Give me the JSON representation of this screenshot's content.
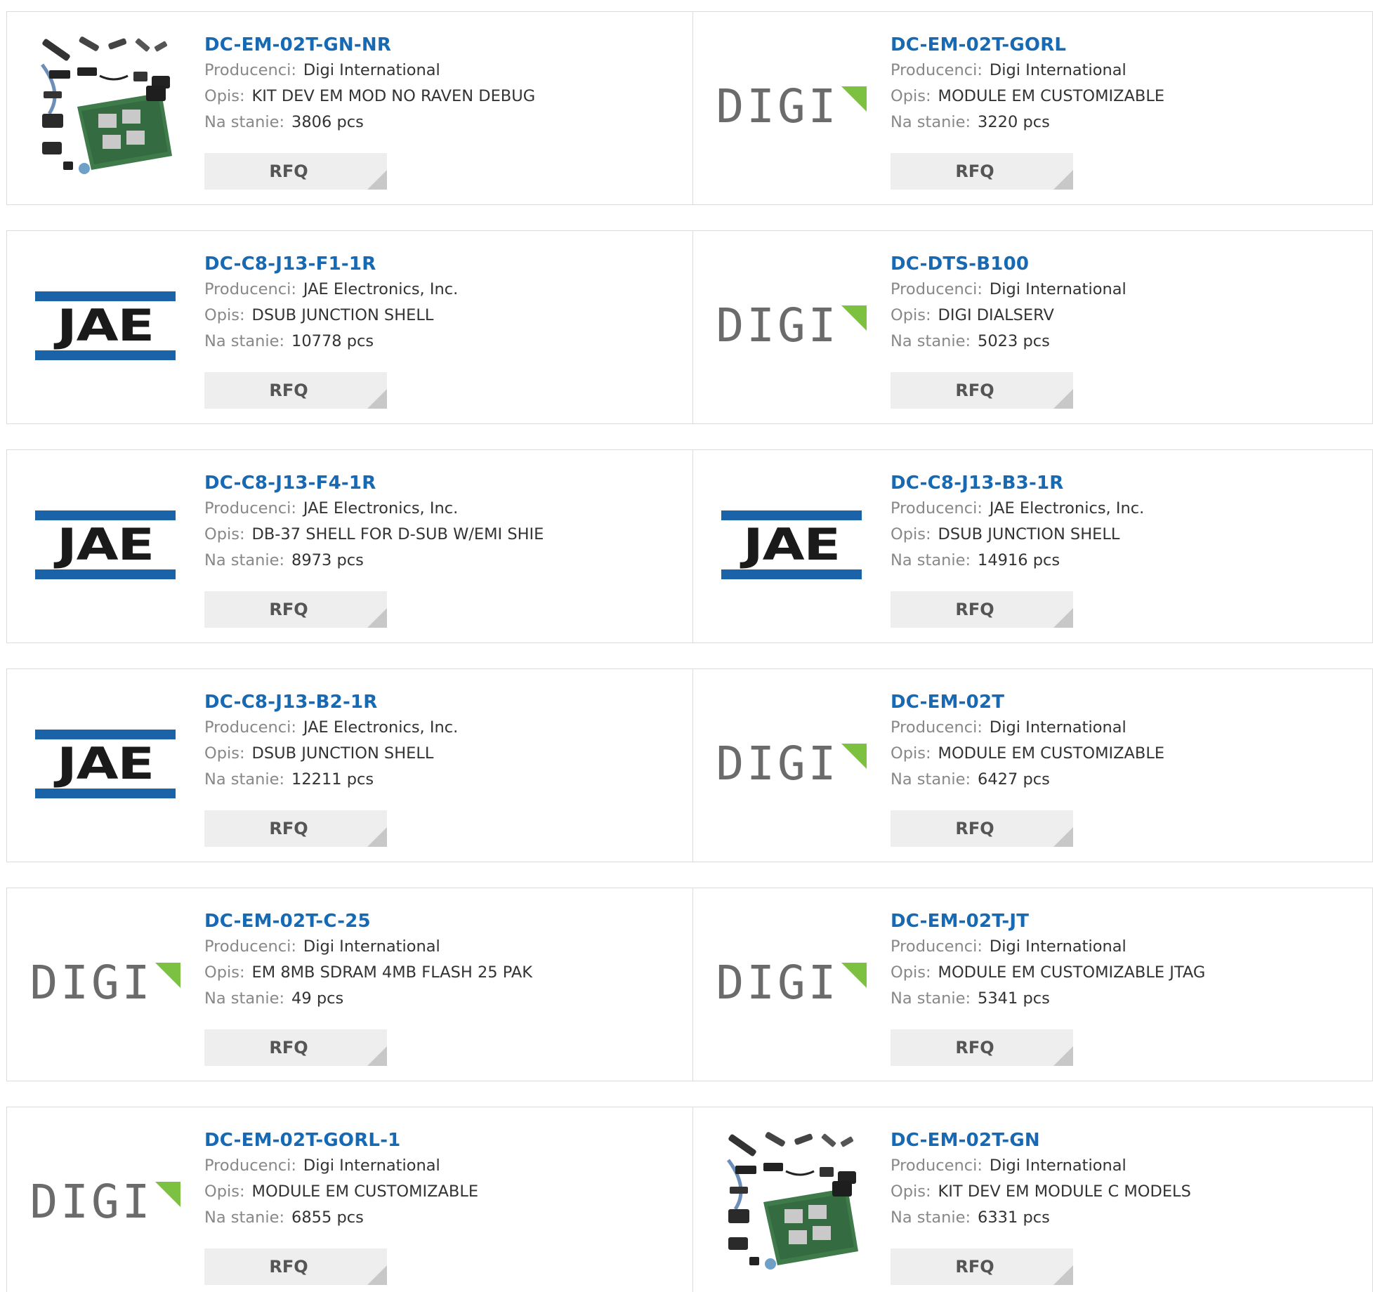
{
  "labels": {
    "manufacturer": "Producenci:",
    "description": "Opis:",
    "stock": "Na stanie:",
    "rfq": "RFQ"
  },
  "products": [
    {
      "part": "DC-EM-02T-GN-NR",
      "manufacturer": "Digi International",
      "description": "KIT DEV EM MOD NO RAVEN DEBUG",
      "stock": "3806 pcs",
      "image": "dev-kit-photo"
    },
    {
      "part": "DC-EM-02T-GORL",
      "manufacturer": "Digi International",
      "description": "MODULE EM CUSTOMIZABLE",
      "stock": "3220 pcs",
      "image": "digi-logo",
      "logo_text": "DIGI"
    },
    {
      "part": "DC-C8-J13-F1-1R",
      "manufacturer": "JAE Electronics, Inc.",
      "description": "DSUB JUNCTION SHELL",
      "stock": "10778 pcs",
      "image": "jae-logo",
      "logo_text": "JAE"
    },
    {
      "part": "DC-DTS-B100",
      "manufacturer": "Digi International",
      "description": "DIGI DIALSERV",
      "stock": "5023 pcs",
      "image": "digi-logo",
      "logo_text": "DIGI"
    },
    {
      "part": "DC-C8-J13-F4-1R",
      "manufacturer": "JAE Electronics, Inc.",
      "description": "DB-37 SHELL FOR D-SUB W/EMI SHIE",
      "stock": "8973 pcs",
      "image": "jae-logo",
      "logo_text": "JAE"
    },
    {
      "part": "DC-C8-J13-B3-1R",
      "manufacturer": "JAE Electronics, Inc.",
      "description": "DSUB JUNCTION SHELL",
      "stock": "14916 pcs",
      "image": "jae-logo",
      "logo_text": "JAE"
    },
    {
      "part": "DC-C8-J13-B2-1R",
      "manufacturer": "JAE Electronics, Inc.",
      "description": "DSUB JUNCTION SHELL",
      "stock": "12211 pcs",
      "image": "jae-logo",
      "logo_text": "JAE"
    },
    {
      "part": "DC-EM-02T",
      "manufacturer": "Digi International",
      "description": "MODULE EM CUSTOMIZABLE",
      "stock": "6427 pcs",
      "image": "digi-logo",
      "logo_text": "DIGI"
    },
    {
      "part": "DC-EM-02T-C-25",
      "manufacturer": "Digi International",
      "description": "EM 8MB SDRAM 4MB FLASH 25 PAK",
      "stock": "49 pcs",
      "image": "digi-logo",
      "logo_text": "DIGI"
    },
    {
      "part": "DC-EM-02T-JT",
      "manufacturer": "Digi International",
      "description": "MODULE EM CUSTOMIZABLE JTAG",
      "stock": "5341 pcs",
      "image": "digi-logo",
      "logo_text": "DIGI"
    },
    {
      "part": "DC-EM-02T-GORL-1",
      "manufacturer": "Digi International",
      "description": "MODULE EM CUSTOMIZABLE",
      "stock": "6855 pcs",
      "image": "digi-logo",
      "logo_text": "DIGI"
    },
    {
      "part": "DC-EM-02T-GN",
      "manufacturer": "Digi International",
      "description": "KIT DEV EM MODULE C MODELS",
      "stock": "6331 pcs",
      "image": "dev-kit-photo"
    }
  ],
  "colors": {
    "link": "#1769b3",
    "label": "#888888",
    "value": "#333333",
    "button_bg": "#eeeeee",
    "jae_blue": "#1b63a8",
    "digi_green": "#7dc142"
  }
}
